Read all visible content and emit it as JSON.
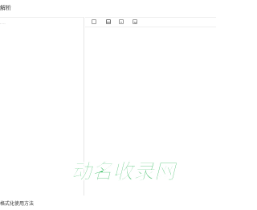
{
  "page": {
    "title": "解析"
  },
  "input_pane": {
    "placeholder_dots": "····"
  },
  "toolbar": {
    "tools": [
      {
        "name": "copy-icon"
      },
      {
        "name": "format-icon"
      },
      {
        "name": "compress-icon"
      },
      {
        "name": "collapse-icon"
      }
    ]
  },
  "footer": {
    "heading": "格式化使用方法"
  },
  "watermark": {
    "text": "动名收录网",
    "color": "#1fb34e"
  }
}
